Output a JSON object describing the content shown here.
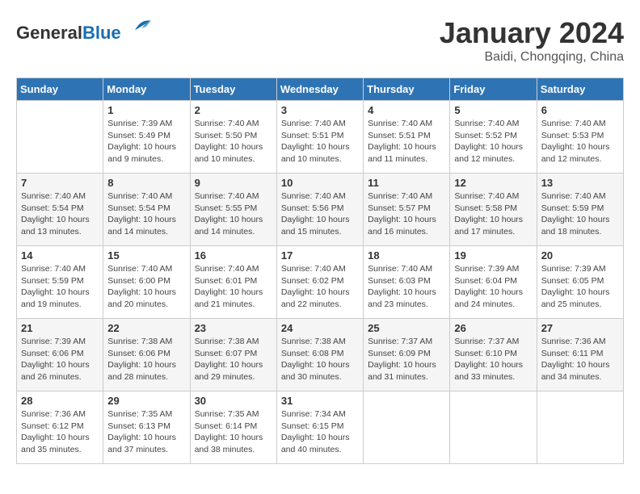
{
  "header": {
    "logo_general": "General",
    "logo_blue": "Blue",
    "month_title": "January 2024",
    "location": "Baidi, Chongqing, China"
  },
  "calendar": {
    "days_of_week": [
      "Sunday",
      "Monday",
      "Tuesday",
      "Wednesday",
      "Thursday",
      "Friday",
      "Saturday"
    ],
    "weeks": [
      [
        {
          "day": "",
          "info": ""
        },
        {
          "day": "1",
          "info": "Sunrise: 7:39 AM\nSunset: 5:49 PM\nDaylight: 10 hours\nand 9 minutes."
        },
        {
          "day": "2",
          "info": "Sunrise: 7:40 AM\nSunset: 5:50 PM\nDaylight: 10 hours\nand 10 minutes."
        },
        {
          "day": "3",
          "info": "Sunrise: 7:40 AM\nSunset: 5:51 PM\nDaylight: 10 hours\nand 10 minutes."
        },
        {
          "day": "4",
          "info": "Sunrise: 7:40 AM\nSunset: 5:51 PM\nDaylight: 10 hours\nand 11 minutes."
        },
        {
          "day": "5",
          "info": "Sunrise: 7:40 AM\nSunset: 5:52 PM\nDaylight: 10 hours\nand 12 minutes."
        },
        {
          "day": "6",
          "info": "Sunrise: 7:40 AM\nSunset: 5:53 PM\nDaylight: 10 hours\nand 12 minutes."
        }
      ],
      [
        {
          "day": "7",
          "info": "Sunrise: 7:40 AM\nSunset: 5:54 PM\nDaylight: 10 hours\nand 13 minutes."
        },
        {
          "day": "8",
          "info": "Sunrise: 7:40 AM\nSunset: 5:54 PM\nDaylight: 10 hours\nand 14 minutes."
        },
        {
          "day": "9",
          "info": "Sunrise: 7:40 AM\nSunset: 5:55 PM\nDaylight: 10 hours\nand 14 minutes."
        },
        {
          "day": "10",
          "info": "Sunrise: 7:40 AM\nSunset: 5:56 PM\nDaylight: 10 hours\nand 15 minutes."
        },
        {
          "day": "11",
          "info": "Sunrise: 7:40 AM\nSunset: 5:57 PM\nDaylight: 10 hours\nand 16 minutes."
        },
        {
          "day": "12",
          "info": "Sunrise: 7:40 AM\nSunset: 5:58 PM\nDaylight: 10 hours\nand 17 minutes."
        },
        {
          "day": "13",
          "info": "Sunrise: 7:40 AM\nSunset: 5:59 PM\nDaylight: 10 hours\nand 18 minutes."
        }
      ],
      [
        {
          "day": "14",
          "info": "Sunrise: 7:40 AM\nSunset: 5:59 PM\nDaylight: 10 hours\nand 19 minutes."
        },
        {
          "day": "15",
          "info": "Sunrise: 7:40 AM\nSunset: 6:00 PM\nDaylight: 10 hours\nand 20 minutes."
        },
        {
          "day": "16",
          "info": "Sunrise: 7:40 AM\nSunset: 6:01 PM\nDaylight: 10 hours\nand 21 minutes."
        },
        {
          "day": "17",
          "info": "Sunrise: 7:40 AM\nSunset: 6:02 PM\nDaylight: 10 hours\nand 22 minutes."
        },
        {
          "day": "18",
          "info": "Sunrise: 7:40 AM\nSunset: 6:03 PM\nDaylight: 10 hours\nand 23 minutes."
        },
        {
          "day": "19",
          "info": "Sunrise: 7:39 AM\nSunset: 6:04 PM\nDaylight: 10 hours\nand 24 minutes."
        },
        {
          "day": "20",
          "info": "Sunrise: 7:39 AM\nSunset: 6:05 PM\nDaylight: 10 hours\nand 25 minutes."
        }
      ],
      [
        {
          "day": "21",
          "info": "Sunrise: 7:39 AM\nSunset: 6:06 PM\nDaylight: 10 hours\nand 26 minutes."
        },
        {
          "day": "22",
          "info": "Sunrise: 7:38 AM\nSunset: 6:06 PM\nDaylight: 10 hours\nand 28 minutes."
        },
        {
          "day": "23",
          "info": "Sunrise: 7:38 AM\nSunset: 6:07 PM\nDaylight: 10 hours\nand 29 minutes."
        },
        {
          "day": "24",
          "info": "Sunrise: 7:38 AM\nSunset: 6:08 PM\nDaylight: 10 hours\nand 30 minutes."
        },
        {
          "day": "25",
          "info": "Sunrise: 7:37 AM\nSunset: 6:09 PM\nDaylight: 10 hours\nand 31 minutes."
        },
        {
          "day": "26",
          "info": "Sunrise: 7:37 AM\nSunset: 6:10 PM\nDaylight: 10 hours\nand 33 minutes."
        },
        {
          "day": "27",
          "info": "Sunrise: 7:36 AM\nSunset: 6:11 PM\nDaylight: 10 hours\nand 34 minutes."
        }
      ],
      [
        {
          "day": "28",
          "info": "Sunrise: 7:36 AM\nSunset: 6:12 PM\nDaylight: 10 hours\nand 35 minutes."
        },
        {
          "day": "29",
          "info": "Sunrise: 7:35 AM\nSunset: 6:13 PM\nDaylight: 10 hours\nand 37 minutes."
        },
        {
          "day": "30",
          "info": "Sunrise: 7:35 AM\nSunset: 6:14 PM\nDaylight: 10 hours\nand 38 minutes."
        },
        {
          "day": "31",
          "info": "Sunrise: 7:34 AM\nSunset: 6:15 PM\nDaylight: 10 hours\nand 40 minutes."
        },
        {
          "day": "",
          "info": ""
        },
        {
          "day": "",
          "info": ""
        },
        {
          "day": "",
          "info": ""
        }
      ]
    ]
  }
}
